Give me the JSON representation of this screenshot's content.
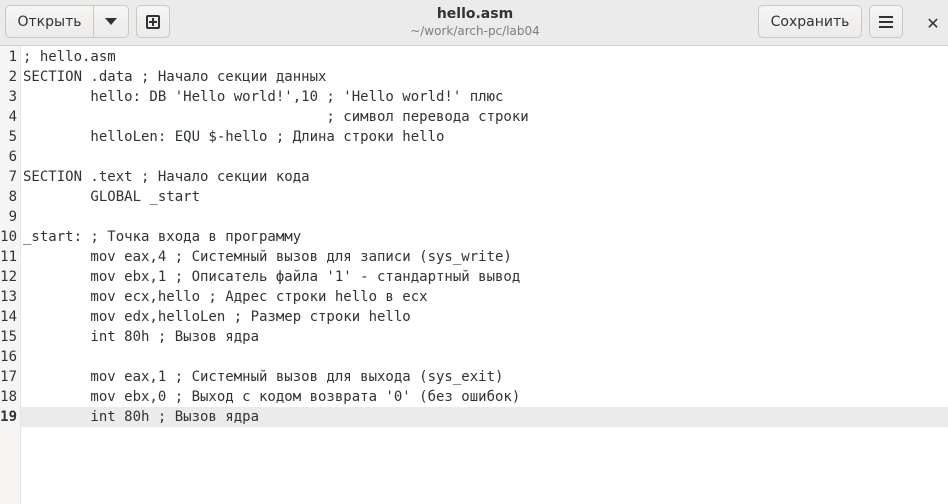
{
  "header": {
    "open_label": "Открыть",
    "title": "hello.asm",
    "subtitle": "~/work/arch-pc/lab04",
    "save_label": "Сохранить",
    "close_glyph": "✕"
  },
  "icons": {
    "open_dropdown": "chevron-down-icon",
    "new_tab": "new-tab-icon",
    "menu": "hamburger-menu-icon",
    "close": "close-icon"
  },
  "editor": {
    "current_line": 19,
    "lines": [
      {
        "num": "1",
        "text": "; hello.asm"
      },
      {
        "num": "2",
        "text": "SECTION .data ; Начало секции данных"
      },
      {
        "num": "3",
        "text": "        hello: DB 'Hello world!',10 ; 'Hello world!' плюс"
      },
      {
        "num": "4",
        "text": "                                    ; символ перевода строки"
      },
      {
        "num": "5",
        "text": "        helloLen: EQU $-hello ; Длина строки hello"
      },
      {
        "num": "6",
        "text": ""
      },
      {
        "num": "7",
        "text": "SECTION .text ; Начало секции кода"
      },
      {
        "num": "8",
        "text": "        GLOBAL _start"
      },
      {
        "num": "9",
        "text": ""
      },
      {
        "num": "10",
        "text": "_start: ; Точка входа в программу"
      },
      {
        "num": "11",
        "text": "        mov eax,4 ; Системный вызов для записи (sys_write)"
      },
      {
        "num": "12",
        "text": "        mov ebx,1 ; Описатель файла '1' - стандартный вывод"
      },
      {
        "num": "13",
        "text": "        mov ecx,hello ; Адрес строки hello в ecx"
      },
      {
        "num": "14",
        "text": "        mov edx,helloLen ; Размер строки hello"
      },
      {
        "num": "15",
        "text": "        int 80h ; Вызов ядра"
      },
      {
        "num": "16",
        "text": ""
      },
      {
        "num": "17",
        "text": "        mov eax,1 ; Системный вызов для выхода (sys_exit)"
      },
      {
        "num": "18",
        "text": "        mov ebx,0 ; Выход с кодом возврата '0' (без ошибок)"
      },
      {
        "num": "19",
        "text": "        int 80h ; Вызов ядра"
      }
    ]
  }
}
